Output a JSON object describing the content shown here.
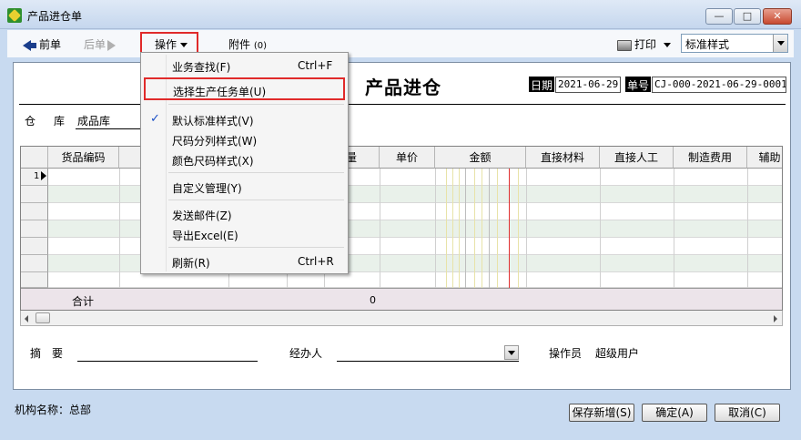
{
  "window": {
    "title": "产品进仓单"
  },
  "toolbar": {
    "prev": "前单",
    "next": "后单",
    "operate": "操作",
    "attach": "附件",
    "attach_count": "(0)",
    "print": "打印",
    "style_value": "标准样式"
  },
  "form": {
    "title": "产品进仓",
    "date_label": "日期",
    "date_value": "2021-06-29",
    "no_label": "单号",
    "no_value": "CJ-000-2021-06-29-0001",
    "warehouse_label": "仓库",
    "warehouse_value": "成品库"
  },
  "table": {
    "columns": [
      "货品编码",
      "",
      "",
      "",
      "量",
      "单价",
      "金额",
      "直接材料",
      "直接人工",
      "制造费用",
      "辅助"
    ],
    "row_indicator": "1",
    "total_label": "合计",
    "total_qty": "0"
  },
  "footer": {
    "remark_label": "摘　要",
    "handler_label": "经办人",
    "operator_label": "操作员",
    "operator_value": "超级用户"
  },
  "status": {
    "org": "机构名称：总部",
    "save_new": "保存新增(S)",
    "ok": "确定(A)",
    "cancel": "取消(C)"
  },
  "menu": {
    "items": [
      {
        "label": "业务查找(F)",
        "shortcut": "Ctrl+F"
      },
      {
        "label": "选择生产任务单(U)",
        "shortcut": ""
      },
      {
        "label": "默认标准样式(V)",
        "shortcut": ""
      },
      {
        "label": "尺码分列样式(W)",
        "shortcut": ""
      },
      {
        "label": "颜色尺码样式(X)",
        "shortcut": ""
      },
      {
        "label": "自定义管理(Y)",
        "shortcut": ""
      },
      {
        "label": "发送邮件(Z)",
        "shortcut": ""
      },
      {
        "label": "导出Excel(E)",
        "shortcut": ""
      },
      {
        "label": "刷新(R)",
        "shortcut": "Ctrl+R"
      }
    ]
  },
  "colors": {
    "highlight": "#e02a2a",
    "row_alt": "#e9f1ea",
    "total_row": "#ece4ea",
    "check": "#1a4fc6"
  }
}
